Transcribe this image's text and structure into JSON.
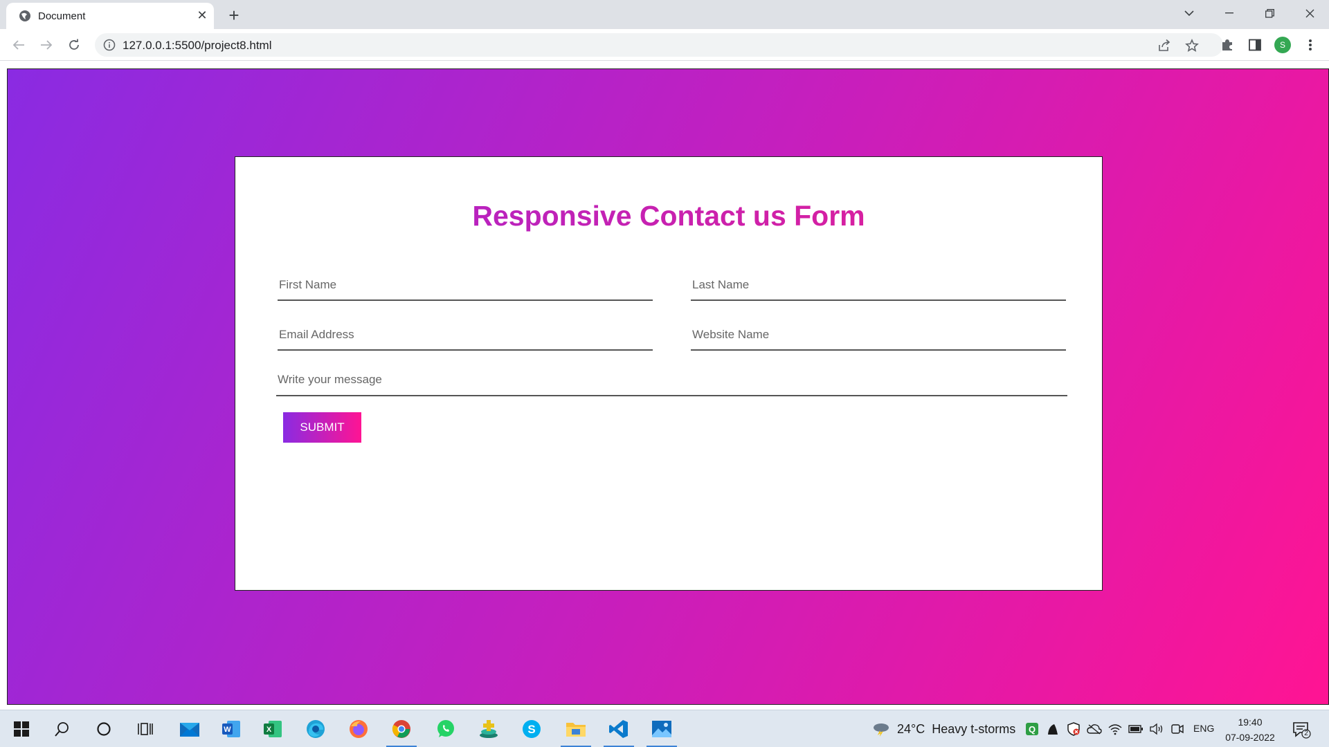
{
  "browser": {
    "tab_title": "Document",
    "url": "127.0.0.1:5500/project8.html",
    "profile_initial": "S"
  },
  "page": {
    "form_title": "Responsive Contact us Form",
    "fields": {
      "first_name_placeholder": "First Name",
      "last_name_placeholder": "Last Name",
      "email_placeholder": "Email Address",
      "website_placeholder": "Website Name",
      "message_placeholder": "Write your message"
    },
    "submit_label": "SUBMIT",
    "colors": {
      "gradient_start": "#8a2be2",
      "gradient_end": "#ff1493"
    }
  },
  "taskbar": {
    "apps": [
      "windows-start",
      "search",
      "cortana",
      "task-view",
      "mail",
      "word",
      "excel",
      "edge",
      "firefox",
      "chrome",
      "whatsapp",
      "app",
      "skype",
      "file-explorer",
      "vscode",
      "photos"
    ],
    "weather_temp": "24°C",
    "weather_text": "Heavy t-storms",
    "language": "ENG",
    "time": "19:40",
    "date": "07-09-2022",
    "notification_count": "2"
  }
}
